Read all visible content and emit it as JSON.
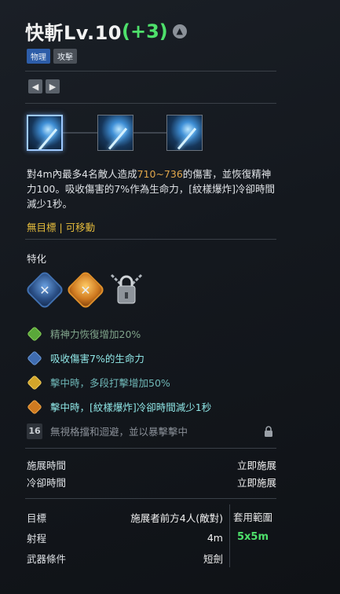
{
  "skill": {
    "name": "快斬Lv.10",
    "level_bonus": "(+3)",
    "tags": [
      "物理",
      "攻擊"
    ]
  },
  "description": {
    "part1": "對4m內最多4名敵人造成",
    "damage": "710~736",
    "part2": "的傷害，並恢復精神力100。吸收傷害的7%作為生命力，[紋樣爆炸]冷卻時間減少1秒。"
  },
  "move_tags": "無目標 | 可移動",
  "specialization": {
    "title": "特化",
    "items": [
      {
        "text": "精神力恢復增加20%",
        "color": "green"
      },
      {
        "text": "吸收傷害7%的生命力",
        "color": "blue"
      },
      {
        "text": "擊中時，多段打擊增加50%",
        "color": "yellow"
      },
      {
        "text": "擊中時，[紋樣爆炸]冷卻時間減少1秒",
        "color": "orange"
      },
      {
        "text": "無視格擋和迴避，並以暴擊擊中",
        "level": "16",
        "locked": true
      }
    ]
  },
  "timing": {
    "cast_label": "施展時間",
    "cast_value": "立即施展",
    "cooldown_label": "冷卻時間",
    "cooldown_value": "立即施展"
  },
  "targeting": {
    "target_label": "目標",
    "target_value": "施展者前方4人(敵對)",
    "range_label": "射程",
    "range_value": "4m",
    "weapon_label": "武器條件",
    "weapon_value": "短劍",
    "area_label": "套用範圍",
    "area_value": "5x5m"
  },
  "colors": {
    "accent_green": "#4ee06b",
    "damage": "#e0a64a",
    "move": "#e6bd3c",
    "cyan": "#8fe6e6"
  },
  "icons": [
    "upgrade-icon",
    "prev-arrow-icon",
    "next-arrow-icon",
    "lock-icon"
  ]
}
